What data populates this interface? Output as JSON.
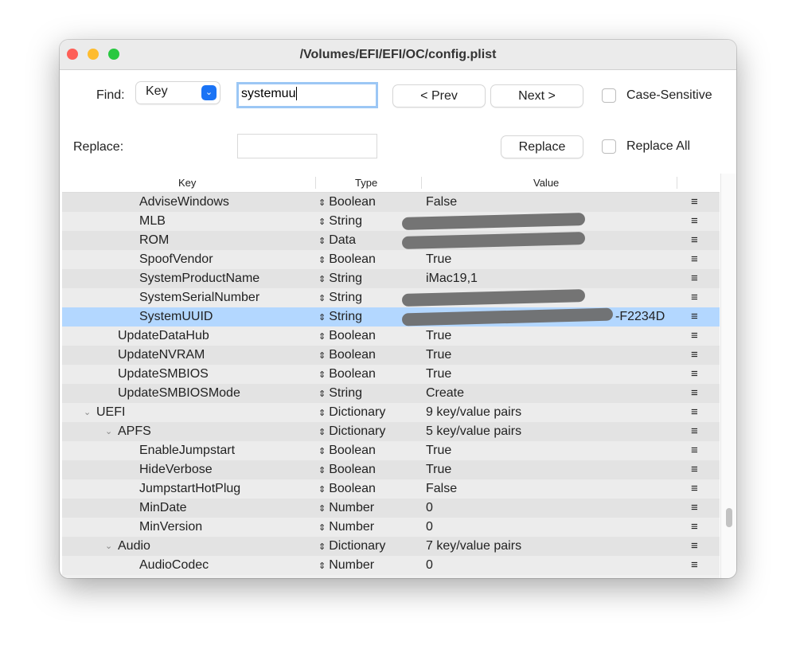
{
  "window": {
    "title": "/Volumes/EFI/EFI/OC/config.plist"
  },
  "find": {
    "label": "Find:",
    "mode": "Key",
    "query": "systemuu",
    "prev": "< Prev",
    "next": "Next >",
    "case_sensitive_label": "Case-Sensitive",
    "case_sensitive": false
  },
  "replace": {
    "label": "Replace:",
    "value": "",
    "button": "Replace",
    "replace_all_label": "Replace All",
    "replace_all": false
  },
  "table": {
    "columns": [
      "Key",
      "Type",
      "Value"
    ],
    "rows": [
      {
        "key": "AdviseWindows",
        "level": 3,
        "type": "Boolean",
        "value": "False"
      },
      {
        "key": "MLB",
        "level": 3,
        "type": "String",
        "value": "",
        "redacted": true
      },
      {
        "key": "ROM",
        "level": 3,
        "type": "Data",
        "value": "",
        "redacted": true
      },
      {
        "key": "SpoofVendor",
        "level": 3,
        "type": "Boolean",
        "value": "True"
      },
      {
        "key": "SystemProductName",
        "level": 3,
        "type": "String",
        "value": "iMac19,1"
      },
      {
        "key": "SystemSerialNumber",
        "level": 3,
        "type": "String",
        "value": "",
        "redacted": true
      },
      {
        "key": "SystemUUID",
        "level": 3,
        "type": "String",
        "value": "-F2234D",
        "redacted": true,
        "selected": true
      },
      {
        "key": "UpdateDataHub",
        "level": 2,
        "type": "Boolean",
        "value": "True"
      },
      {
        "key": "UpdateNVRAM",
        "level": 2,
        "type": "Boolean",
        "value": "True"
      },
      {
        "key": "UpdateSMBIOS",
        "level": 2,
        "type": "Boolean",
        "value": "True"
      },
      {
        "key": "UpdateSMBIOSMode",
        "level": 2,
        "type": "String",
        "value": "Create"
      },
      {
        "key": "UEFI",
        "level": 1,
        "type": "Dictionary",
        "value": "9 key/value pairs",
        "expanded": true
      },
      {
        "key": "APFS",
        "level": 2,
        "type": "Dictionary",
        "value": "5 key/value pairs",
        "expanded": true
      },
      {
        "key": "EnableJumpstart",
        "level": 3,
        "type": "Boolean",
        "value": "True"
      },
      {
        "key": "HideVerbose",
        "level": 3,
        "type": "Boolean",
        "value": "True"
      },
      {
        "key": "JumpstartHotPlug",
        "level": 3,
        "type": "Boolean",
        "value": "False"
      },
      {
        "key": "MinDate",
        "level": 3,
        "type": "Number",
        "value": "0"
      },
      {
        "key": "MinVersion",
        "level": 3,
        "type": "Number",
        "value": "0"
      },
      {
        "key": "Audio",
        "level": 2,
        "type": "Dictionary",
        "value": "7 key/value pairs",
        "expanded": true
      },
      {
        "key": "AudioCodec",
        "level": 3,
        "type": "Number",
        "value": "0"
      }
    ]
  },
  "icons": {
    "row_menu": "≡",
    "type_stepper": "⇕",
    "disclosure": "⌄"
  },
  "colors": {
    "selection": "#b3d7ff",
    "accent": "#1a73f5",
    "close": "#fe5f57",
    "minimize": "#febc2e",
    "zoom": "#28c840"
  }
}
